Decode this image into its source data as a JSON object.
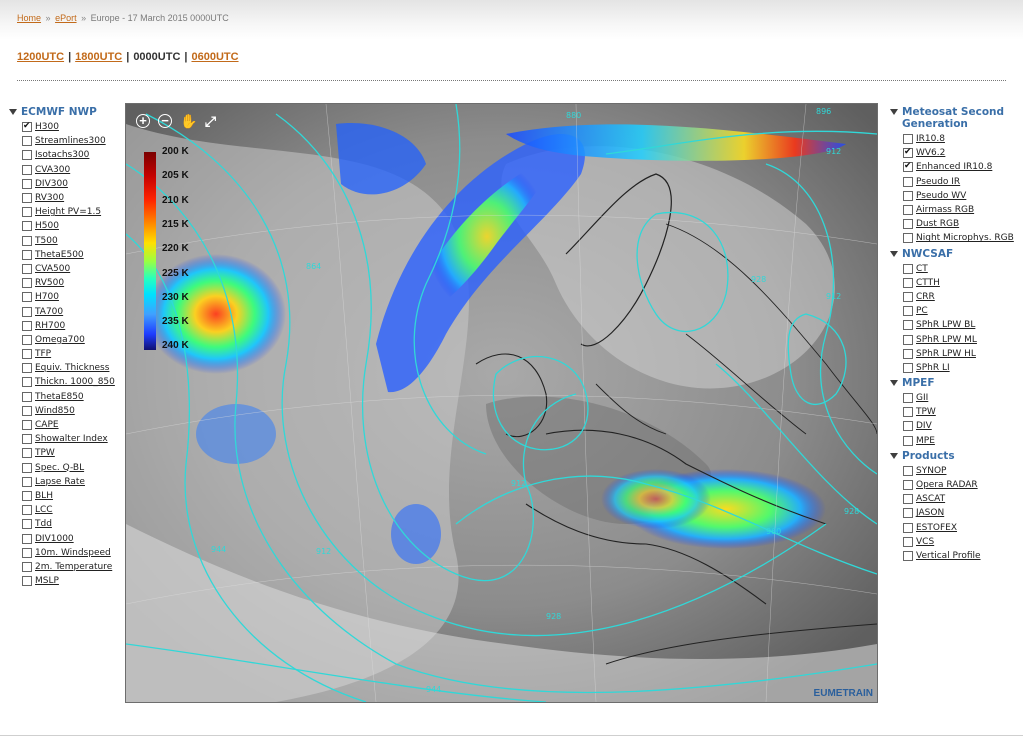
{
  "breadcrumb": {
    "home": "Home",
    "sep1": "»",
    "eport": "ePort",
    "sep2": "»",
    "current": "Europe - 17 March 2015 0000UTC"
  },
  "times": [
    {
      "label": "1200UTC",
      "link": true
    },
    {
      "label": "1800UTC",
      "link": true
    },
    {
      "label": "0000UTC",
      "link": false
    },
    {
      "label": "0600UTC",
      "link": true
    }
  ],
  "time_separator": "|",
  "left_panel": {
    "title": "ECMWF NWP",
    "items": [
      {
        "label": "H300",
        "checked": true
      },
      {
        "label": "Streamlines300",
        "checked": false
      },
      {
        "label": "Isotachs300",
        "checked": false
      },
      {
        "label": "CVA300",
        "checked": false
      },
      {
        "label": "DIV300",
        "checked": false
      },
      {
        "label": "RV300",
        "checked": false
      },
      {
        "label": "Height PV=1.5",
        "checked": false
      },
      {
        "label": "H500",
        "checked": false
      },
      {
        "label": "T500",
        "checked": false
      },
      {
        "label": "ThetaE500",
        "checked": false
      },
      {
        "label": "CVA500",
        "checked": false
      },
      {
        "label": "RV500",
        "checked": false
      },
      {
        "label": "H700",
        "checked": false
      },
      {
        "label": "TA700",
        "checked": false
      },
      {
        "label": "RH700",
        "checked": false
      },
      {
        "label": "Omega700",
        "checked": false
      },
      {
        "label": "TFP",
        "checked": false
      },
      {
        "label": "Equiv. Thickness",
        "checked": false
      },
      {
        "label": "Thickn. 1000_850",
        "checked": false
      },
      {
        "label": "ThetaE850",
        "checked": false
      },
      {
        "label": "Wind850",
        "checked": false
      },
      {
        "label": "CAPE",
        "checked": false
      },
      {
        "label": "Showalter Index",
        "checked": false
      },
      {
        "label": "TPW",
        "checked": false
      },
      {
        "label": "Spec. Q-BL",
        "checked": false
      },
      {
        "label": "Lapse Rate",
        "checked": false
      },
      {
        "label": "BLH",
        "checked": false
      },
      {
        "label": "LCC",
        "checked": false
      },
      {
        "label": "Tdd",
        "checked": false
      },
      {
        "label": "DIV1000",
        "checked": false
      },
      {
        "label": "10m. Windspeed",
        "checked": false
      },
      {
        "label": "2m. Temperature",
        "checked": false
      },
      {
        "label": "MSLP",
        "checked": false
      }
    ]
  },
  "right_panel": {
    "groups": [
      {
        "title": "Meteosat Second Generation",
        "items": [
          {
            "label": "IR10.8",
            "checked": false
          },
          {
            "label": "WV6.2",
            "checked": true
          },
          {
            "label": "Enhanced IR10.8",
            "checked": true
          },
          {
            "label": "Pseudo IR",
            "checked": false
          },
          {
            "label": "Pseudo WV",
            "checked": false
          },
          {
            "label": "Airmass RGB",
            "checked": false
          },
          {
            "label": "Dust RGB",
            "checked": false
          },
          {
            "label": "Night Microphys. RGB",
            "checked": false
          }
        ]
      },
      {
        "title": "NWCSAF",
        "items": [
          {
            "label": "CT",
            "checked": false
          },
          {
            "label": "CTTH",
            "checked": false
          },
          {
            "label": "CRR",
            "checked": false
          },
          {
            "label": "PC",
            "checked": false
          },
          {
            "label": "SPhR LPW BL",
            "checked": false
          },
          {
            "label": "SPhR LPW ML",
            "checked": false
          },
          {
            "label": "SPhR LPW HL",
            "checked": false
          },
          {
            "label": "SPhR LI",
            "checked": false
          }
        ]
      },
      {
        "title": "MPEF",
        "items": [
          {
            "label": "GII",
            "checked": false
          },
          {
            "label": "TPW",
            "checked": false
          },
          {
            "label": "DIV",
            "checked": false
          },
          {
            "label": "MPE",
            "checked": false
          }
        ]
      },
      {
        "title": "Products",
        "items": [
          {
            "label": "SYNOP",
            "checked": false
          },
          {
            "label": "Opera RADAR",
            "checked": false
          },
          {
            "label": "ASCAT",
            "checked": false
          },
          {
            "label": "JASON",
            "checked": false
          },
          {
            "label": "ESTOFEX",
            "checked": false
          },
          {
            "label": "VCS",
            "checked": false
          },
          {
            "label": "Vertical Profile",
            "checked": false
          }
        ]
      }
    ]
  },
  "map": {
    "tools": [
      {
        "icon": "zoom-in-icon",
        "glyph": "+"
      },
      {
        "icon": "zoom-out-icon",
        "glyph": "−"
      },
      {
        "icon": "pan-hand-icon",
        "glyph": "✋"
      },
      {
        "icon": "fullscreen-icon",
        "glyph": "⤢"
      }
    ],
    "legend": [
      "200 K",
      "205 K",
      "210 K",
      "215 K",
      "220 K",
      "225 K",
      "230 K",
      "235 K",
      "240 K"
    ],
    "isoline_labels": [
      "896",
      "880",
      "864",
      "912",
      "928",
      "944",
      "912",
      "912",
      "928",
      "944",
      "912",
      "928",
      "960"
    ],
    "watermark": "EUMETRAIN",
    "contour_color": "#30d8d8"
  }
}
